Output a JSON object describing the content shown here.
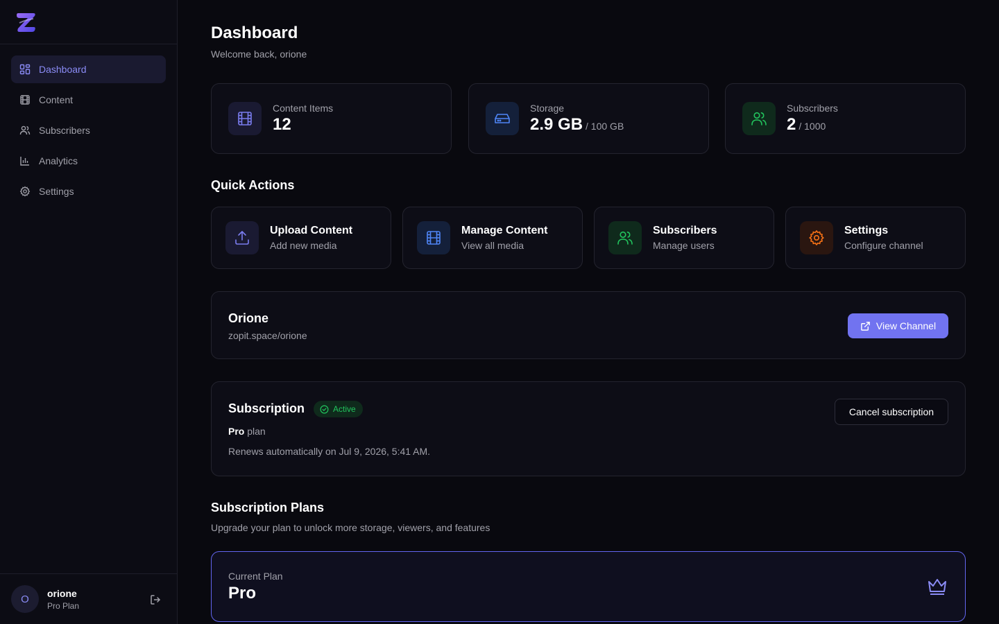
{
  "sidebar": {
    "items": [
      {
        "label": "Dashboard",
        "icon": "grid-icon",
        "active": true
      },
      {
        "label": "Content",
        "icon": "film-icon"
      },
      {
        "label": "Subscribers",
        "icon": "users-icon"
      },
      {
        "label": "Analytics",
        "icon": "bar-chart-icon"
      },
      {
        "label": "Settings",
        "icon": "gear-icon"
      }
    ],
    "user": {
      "initial": "O",
      "name": "orione",
      "plan": "Pro Plan"
    }
  },
  "header": {
    "title": "Dashboard",
    "subtitle": "Welcome back, orione"
  },
  "stats": [
    {
      "label": "Content Items",
      "value": "12",
      "suffix": ""
    },
    {
      "label": "Storage",
      "value": "2.9 GB",
      "suffix": "/ 100 GB"
    },
    {
      "label": "Subscribers",
      "value": "2",
      "suffix": "/ 1000"
    }
  ],
  "quick_actions": {
    "title": "Quick Actions",
    "items": [
      {
        "title": "Upload Content",
        "subtitle": "Add new media"
      },
      {
        "title": "Manage Content",
        "subtitle": "View all media"
      },
      {
        "title": "Subscribers",
        "subtitle": "Manage users"
      },
      {
        "title": "Settings",
        "subtitle": "Configure channel"
      }
    ]
  },
  "channel": {
    "name": "Orione",
    "url": "zopit.space/orione",
    "button": "View Channel"
  },
  "subscription": {
    "title": "Subscription",
    "status": "Active",
    "plan_name": "Pro",
    "plan_word": "plan",
    "renewal": "Renews automatically on Jul 9, 2026, 5:41 AM.",
    "cancel_label": "Cancel subscription"
  },
  "plans": {
    "title": "Subscription Plans",
    "subtitle": "Upgrade your plan to unlock more storage, viewers, and features",
    "current_label": "Current Plan",
    "current_name": "Pro"
  },
  "colors": {
    "background": "#09090f",
    "accent": "#7173f0",
    "success": "#22c55e",
    "warning": "#f97316",
    "info": "#4f86f7"
  }
}
